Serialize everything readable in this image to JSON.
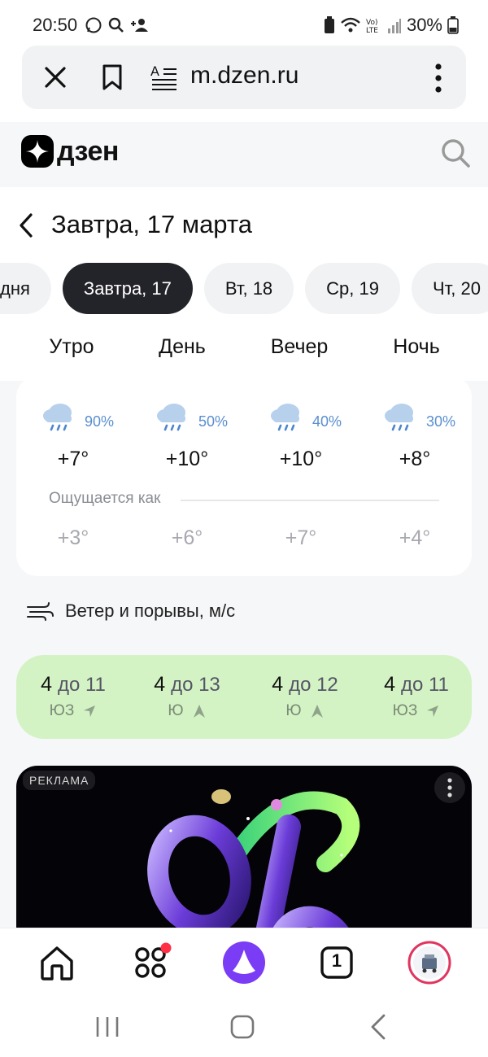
{
  "status_bar": {
    "time": "20:50",
    "battery": "30%"
  },
  "browser": {
    "url": "m.dzen.ru"
  },
  "dzen": {
    "logo_text": "дзен"
  },
  "page": {
    "title": "Завтра, 17 марта",
    "day_tabs": [
      "дня",
      "Завтра, 17",
      "Вт, 18",
      "Ср, 19",
      "Чт, 20"
    ],
    "periods": [
      "Утро",
      "День",
      "Вечер",
      "Ночь"
    ],
    "forecast": [
      {
        "prob": "90%",
        "temp": "+7°",
        "feels": "+3°"
      },
      {
        "prob": "50%",
        "temp": "+10°",
        "feels": "+6°"
      },
      {
        "prob": "40%",
        "temp": "+10°",
        "feels": "+7°"
      },
      {
        "prob": "30%",
        "temp": "+8°",
        "feels": "+4°"
      }
    ],
    "feels_label": "Ощущается как",
    "wind_label": "Ветер и порывы, м/с",
    "wind": [
      {
        "speed": "4",
        "gust": "до 11",
        "dir": "ЮЗ",
        "icon": "arrow-northeast-icon"
      },
      {
        "speed": "4",
        "gust": "до 13",
        "dir": "Ю",
        "icon": "arrow-north-icon"
      },
      {
        "speed": "4",
        "gust": "до 12",
        "dir": "Ю",
        "icon": "arrow-north-icon"
      },
      {
        "speed": "4",
        "gust": "до 11",
        "dir": "ЮЗ",
        "icon": "arrow-northeast-icon"
      }
    ],
    "ad_label": "РЕКЛАМА"
  },
  "bottom_nav": {
    "tabs_count": "1"
  },
  "colors": {
    "wind_bg": "#d3f3c4",
    "active_tab": "#23232a",
    "alice": "#7a3cf5",
    "prob_blue": "#5a8fd0"
  }
}
